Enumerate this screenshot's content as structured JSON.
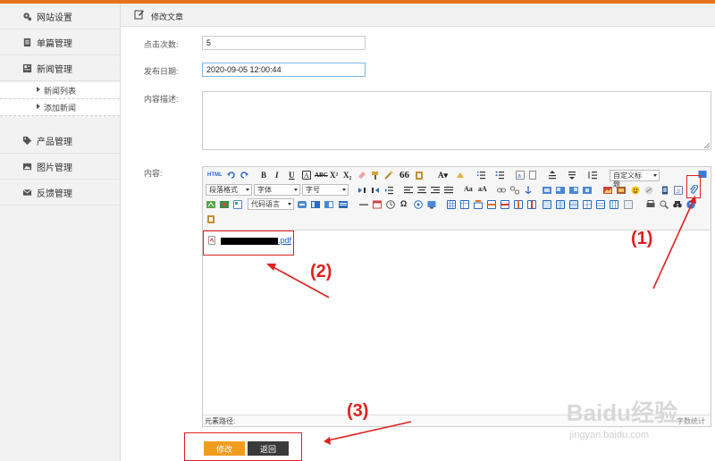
{
  "sidebar": {
    "items": [
      {
        "label": "网站设置",
        "icon": "gear-icon"
      },
      {
        "label": "单篇管理",
        "icon": "document-icon"
      },
      {
        "label": "新闻管理",
        "icon": "news-icon"
      }
    ],
    "subitems": [
      {
        "label": "新闻列表"
      },
      {
        "label": "添加新闻"
      }
    ],
    "items2": [
      {
        "label": "产品管理",
        "icon": "tag-icon"
      },
      {
        "label": "图片管理",
        "icon": "image-icon"
      },
      {
        "label": "反馈管理",
        "icon": "mail-icon"
      }
    ]
  },
  "header": {
    "title": "修改文章",
    "icon": "edit-icon"
  },
  "form": {
    "clicks_label": "点击次数:",
    "clicks_value": "5",
    "date_label": "发布日期:",
    "date_value": "2020-09-05 12:00:44",
    "desc_label": "内容描述:",
    "content_label": "内容:"
  },
  "editor": {
    "selects": {
      "paragraph": "段落格式",
      "font": "字体",
      "size": "字号",
      "code": "代码语言",
      "custom": "自定义标题"
    },
    "file_link_suffix": ".pdf",
    "status_left": "元素路径:",
    "status_right": "字数统计"
  },
  "buttons": {
    "submit": "修改",
    "back": "返回"
  },
  "annotations": {
    "a1": "(1)",
    "a2": "(2)",
    "a3": "(3)"
  },
  "watermark": {
    "brand": "Baidu经验",
    "url": "jingyan.baidu.com"
  },
  "colors": {
    "accent": "#e8731e",
    "annotation": "#e02020",
    "primary_button": "#f29c1f",
    "secondary_button": "#3a3a3a"
  }
}
